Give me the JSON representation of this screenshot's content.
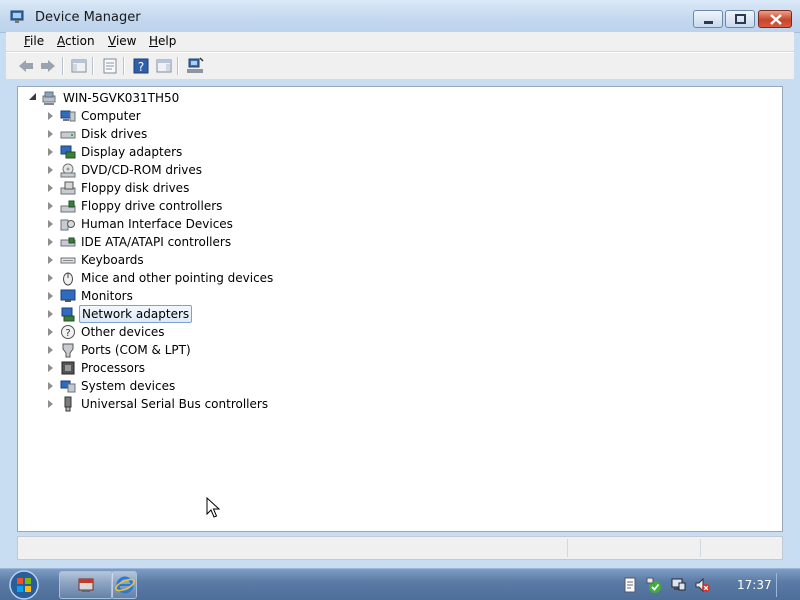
{
  "window": {
    "title": "Device Manager",
    "controls": {
      "minimize": "minimize",
      "maximize": "maximize",
      "close": "close"
    }
  },
  "menu": [
    {
      "label": "File",
      "accel": "F"
    },
    {
      "label": "Action",
      "accel": "A"
    },
    {
      "label": "View",
      "accel": "V"
    },
    {
      "label": "Help",
      "accel": "H"
    }
  ],
  "toolbar": [
    "back-icon",
    "forward-icon",
    "show-hide-tree-icon",
    "properties-icon",
    "help-icon",
    "show-hide-action-pane-icon",
    "scan-hardware-icon"
  ],
  "tree": {
    "root": "WIN-5GVK031TH50",
    "categories": [
      {
        "label": "Computer",
        "icon": "computer-icon"
      },
      {
        "label": "Disk drives",
        "icon": "disk-drive-icon"
      },
      {
        "label": "Display adapters",
        "icon": "display-adapter-icon"
      },
      {
        "label": "DVD/CD-ROM drives",
        "icon": "dvd-drive-icon"
      },
      {
        "label": "Floppy disk drives",
        "icon": "floppy-drive-icon"
      },
      {
        "label": "Floppy drive controllers",
        "icon": "floppy-controller-icon"
      },
      {
        "label": "Human Interface Devices",
        "icon": "hid-icon"
      },
      {
        "label": "IDE ATA/ATAPI controllers",
        "icon": "ide-controller-icon"
      },
      {
        "label": "Keyboards",
        "icon": "keyboard-icon"
      },
      {
        "label": "Mice and other pointing devices",
        "icon": "mouse-icon"
      },
      {
        "label": "Monitors",
        "icon": "monitor-icon"
      },
      {
        "label": "Network adapters",
        "icon": "network-adapter-icon",
        "selected": true
      },
      {
        "label": "Other devices",
        "icon": "unknown-device-icon"
      },
      {
        "label": "Ports (COM & LPT)",
        "icon": "port-icon"
      },
      {
        "label": "Processors",
        "icon": "processor-icon"
      },
      {
        "label": "System devices",
        "icon": "system-device-icon"
      },
      {
        "label": "Universal Serial Bus controllers",
        "icon": "usb-icon"
      }
    ]
  },
  "taskbar": {
    "clock": "17:37",
    "pinned": [
      "device-manager-task-icon",
      "internet-explorer-icon"
    ],
    "tray": [
      "action-center-icon",
      "security-check-icon",
      "network-icon",
      "volume-muted-icon"
    ]
  }
}
